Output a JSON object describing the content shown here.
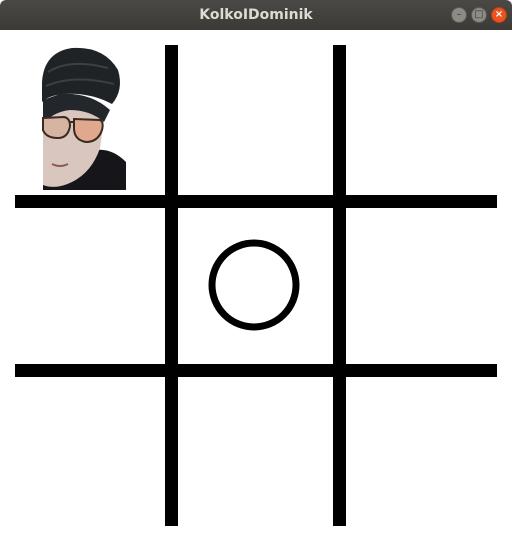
{
  "window": {
    "title": "KolkoIDominik",
    "minimize_glyph": "–",
    "maximize_glyph": "□",
    "close_glyph": "×"
  },
  "board": {
    "cells": [
      "dominik",
      "",
      "",
      "",
      "O",
      "",
      "",
      "",
      ""
    ],
    "line_color": "#000000",
    "background": "#ffffff",
    "circle_color": "#000000"
  },
  "icons": {
    "player_x": "dominik-face-icon",
    "player_o": "circle-icon"
  }
}
